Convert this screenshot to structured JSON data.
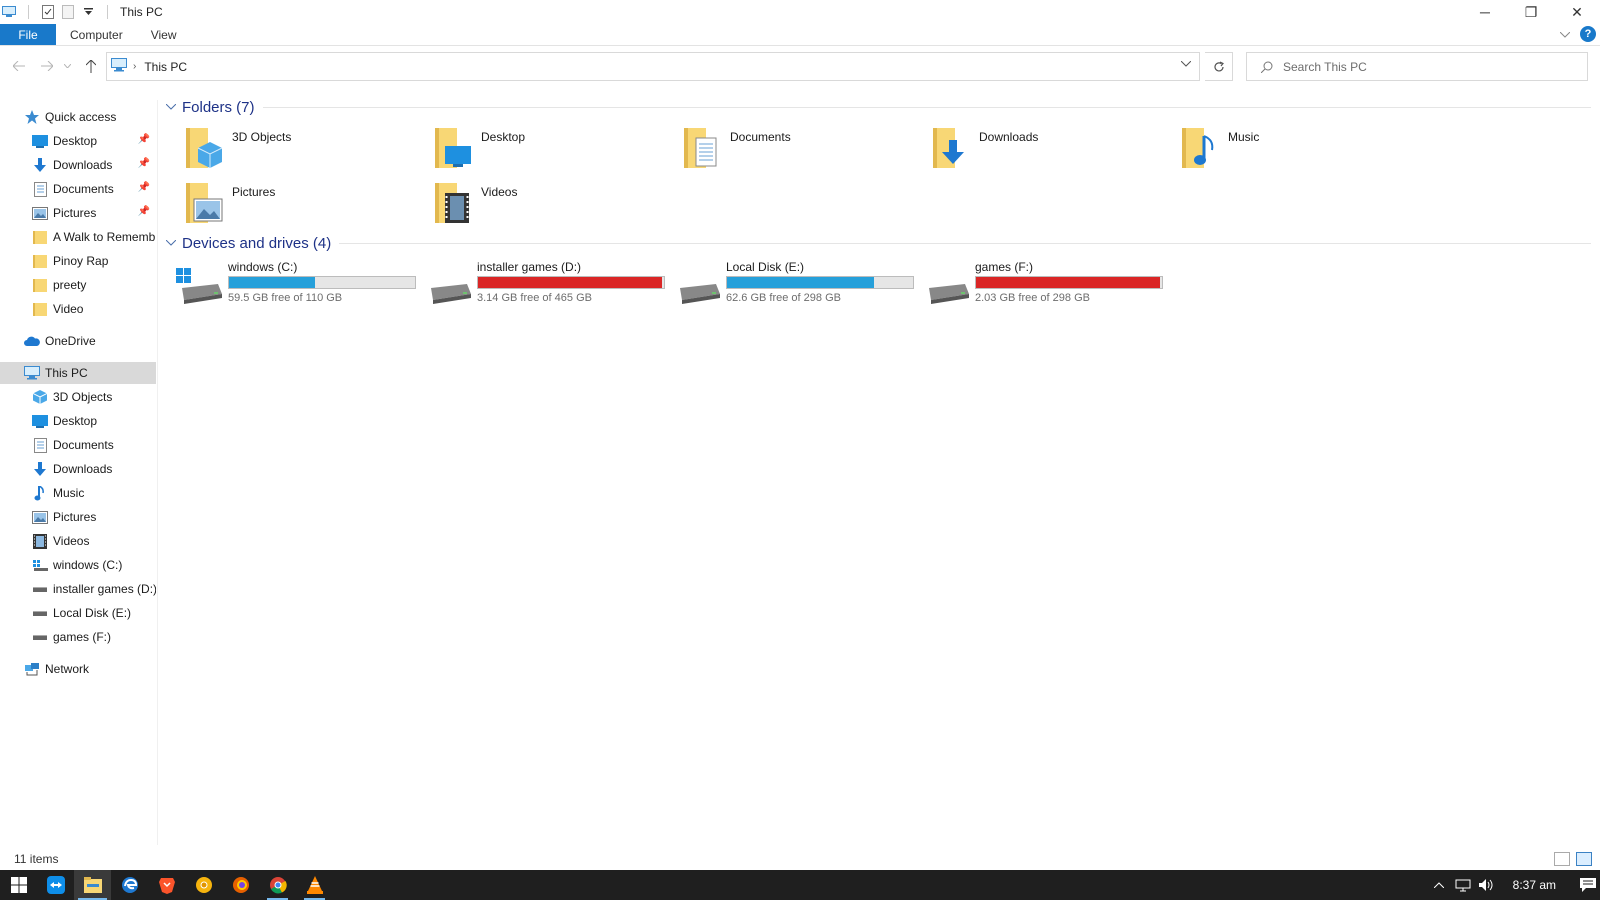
{
  "window": {
    "title": "This PC",
    "minimize": "─",
    "restore": "❐",
    "close": "✕"
  },
  "ribbon": {
    "tabs": [
      "File",
      "Computer",
      "View"
    ],
    "help": "?"
  },
  "address": {
    "location": "This PC",
    "search_placeholder": "Search This PC"
  },
  "sidebar": {
    "quick_access": "Quick access",
    "quick_items": [
      {
        "label": "Desktop",
        "icon": "desktop-icon",
        "pinned": true
      },
      {
        "label": "Downloads",
        "icon": "downloads-icon",
        "pinned": true
      },
      {
        "label": "Documents",
        "icon": "documents-icon",
        "pinned": true
      },
      {
        "label": "Pictures",
        "icon": "pictures-icon",
        "pinned": true
      },
      {
        "label": "A Walk to Rememb",
        "icon": "folder-icon",
        "pinned": false
      },
      {
        "label": "Pinoy Rap",
        "icon": "folder-icon",
        "pinned": false
      },
      {
        "label": "preety",
        "icon": "folder-icon",
        "pinned": false
      },
      {
        "label": "Video",
        "icon": "folder-icon",
        "pinned": false
      }
    ],
    "onedrive": "OneDrive",
    "this_pc": "This PC",
    "pc_items": [
      {
        "label": "3D Objects",
        "icon": "3d-objects-icon"
      },
      {
        "label": "Desktop",
        "icon": "desktop-icon"
      },
      {
        "label": "Documents",
        "icon": "documents-icon"
      },
      {
        "label": "Downloads",
        "icon": "downloads-icon"
      },
      {
        "label": "Music",
        "icon": "music-icon"
      },
      {
        "label": "Pictures",
        "icon": "pictures-icon"
      },
      {
        "label": "Videos",
        "icon": "videos-icon"
      },
      {
        "label": "windows (C:)",
        "icon": "windows-drive-icon"
      },
      {
        "label": "installer games (D:)",
        "icon": "drive-icon"
      },
      {
        "label": "Local Disk (E:)",
        "icon": "drive-icon"
      },
      {
        "label": "games (F:)",
        "icon": "drive-icon"
      }
    ],
    "network": "Network"
  },
  "content": {
    "folders_header": "Folders (7)",
    "folders": [
      {
        "label": "3D Objects",
        "icon": "3d-objects-folder-icon"
      },
      {
        "label": "Desktop",
        "icon": "desktop-folder-icon"
      },
      {
        "label": "Documents",
        "icon": "documents-folder-icon"
      },
      {
        "label": "Downloads",
        "icon": "downloads-folder-icon"
      },
      {
        "label": "Music",
        "icon": "music-folder-icon"
      },
      {
        "label": "Pictures",
        "icon": "pictures-folder-icon"
      },
      {
        "label": "Videos",
        "icon": "videos-folder-icon"
      }
    ],
    "drives_header": "Devices and drives (4)",
    "drives": [
      {
        "name": "windows (C:)",
        "free": "59.5 GB free of 110 GB",
        "used_fraction": 0.46,
        "bar_color": "#26a0da",
        "icon": "windows-drive-icon"
      },
      {
        "name": "installer games (D:)",
        "free": "3.14 GB free of 465 GB",
        "used_fraction": 0.99,
        "bar_color": "#da2626",
        "icon": "drive-icon"
      },
      {
        "name": "Local Disk (E:)",
        "free": "62.6 GB free of 298 GB",
        "used_fraction": 0.79,
        "bar_color": "#26a0da",
        "icon": "drive-icon"
      },
      {
        "name": "games (F:)",
        "free": "2.03 GB free of 298 GB",
        "used_fraction": 0.99,
        "bar_color": "#da2626",
        "icon": "drive-icon"
      }
    ]
  },
  "status": {
    "items": "11 items"
  },
  "taskbar": {
    "clock": "8:37 am",
    "apps": [
      "start-icon",
      "teamviewer-icon",
      "file-explorer-icon",
      "edge-icon",
      "brave-icon",
      "chrome-canary-icon",
      "firefox-icon",
      "chrome-icon",
      "vlc-icon"
    ]
  },
  "colors": {
    "accent": "#1979ca",
    "header_blue": "#1e3287",
    "bar_ok": "#26a0da",
    "bar_full": "#da2626"
  }
}
